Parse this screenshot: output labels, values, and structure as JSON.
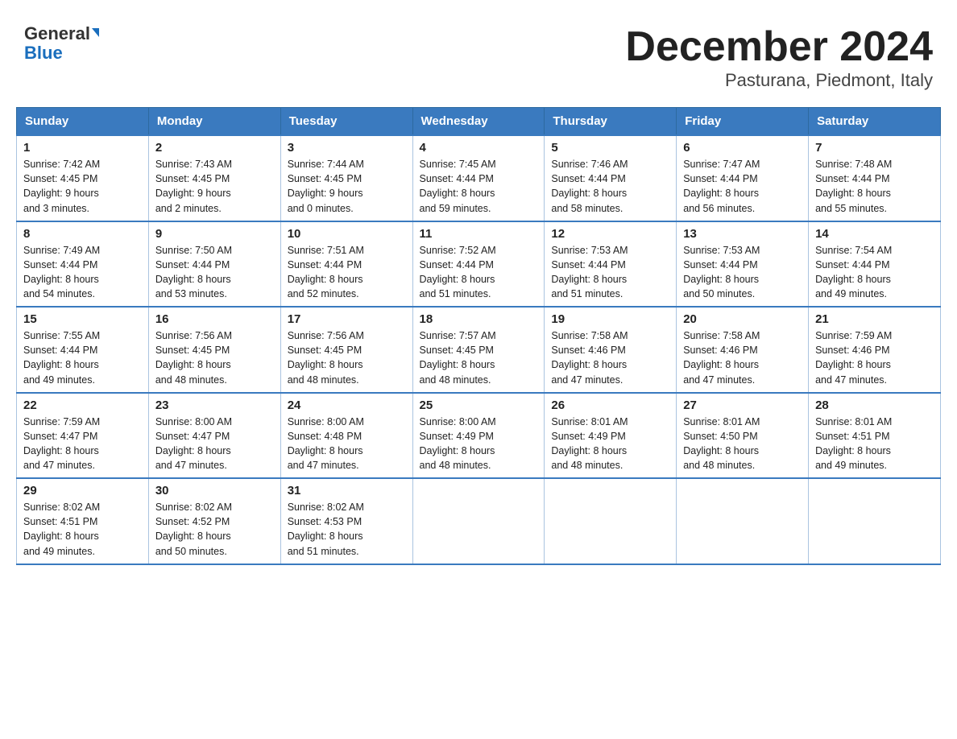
{
  "logo": {
    "general": "General",
    "arrow": "▶",
    "blue": "Blue"
  },
  "title": "December 2024",
  "subtitle": "Pasturana, Piedmont, Italy",
  "days_of_week": [
    "Sunday",
    "Monday",
    "Tuesday",
    "Wednesday",
    "Thursday",
    "Friday",
    "Saturday"
  ],
  "weeks": [
    [
      {
        "day": "1",
        "info": "Sunrise: 7:42 AM\nSunset: 4:45 PM\nDaylight: 9 hours\nand 3 minutes."
      },
      {
        "day": "2",
        "info": "Sunrise: 7:43 AM\nSunset: 4:45 PM\nDaylight: 9 hours\nand 2 minutes."
      },
      {
        "day": "3",
        "info": "Sunrise: 7:44 AM\nSunset: 4:45 PM\nDaylight: 9 hours\nand 0 minutes."
      },
      {
        "day": "4",
        "info": "Sunrise: 7:45 AM\nSunset: 4:44 PM\nDaylight: 8 hours\nand 59 minutes."
      },
      {
        "day": "5",
        "info": "Sunrise: 7:46 AM\nSunset: 4:44 PM\nDaylight: 8 hours\nand 58 minutes."
      },
      {
        "day": "6",
        "info": "Sunrise: 7:47 AM\nSunset: 4:44 PM\nDaylight: 8 hours\nand 56 minutes."
      },
      {
        "day": "7",
        "info": "Sunrise: 7:48 AM\nSunset: 4:44 PM\nDaylight: 8 hours\nand 55 minutes."
      }
    ],
    [
      {
        "day": "8",
        "info": "Sunrise: 7:49 AM\nSunset: 4:44 PM\nDaylight: 8 hours\nand 54 minutes."
      },
      {
        "day": "9",
        "info": "Sunrise: 7:50 AM\nSunset: 4:44 PM\nDaylight: 8 hours\nand 53 minutes."
      },
      {
        "day": "10",
        "info": "Sunrise: 7:51 AM\nSunset: 4:44 PM\nDaylight: 8 hours\nand 52 minutes."
      },
      {
        "day": "11",
        "info": "Sunrise: 7:52 AM\nSunset: 4:44 PM\nDaylight: 8 hours\nand 51 minutes."
      },
      {
        "day": "12",
        "info": "Sunrise: 7:53 AM\nSunset: 4:44 PM\nDaylight: 8 hours\nand 51 minutes."
      },
      {
        "day": "13",
        "info": "Sunrise: 7:53 AM\nSunset: 4:44 PM\nDaylight: 8 hours\nand 50 minutes."
      },
      {
        "day": "14",
        "info": "Sunrise: 7:54 AM\nSunset: 4:44 PM\nDaylight: 8 hours\nand 49 minutes."
      }
    ],
    [
      {
        "day": "15",
        "info": "Sunrise: 7:55 AM\nSunset: 4:44 PM\nDaylight: 8 hours\nand 49 minutes."
      },
      {
        "day": "16",
        "info": "Sunrise: 7:56 AM\nSunset: 4:45 PM\nDaylight: 8 hours\nand 48 minutes."
      },
      {
        "day": "17",
        "info": "Sunrise: 7:56 AM\nSunset: 4:45 PM\nDaylight: 8 hours\nand 48 minutes."
      },
      {
        "day": "18",
        "info": "Sunrise: 7:57 AM\nSunset: 4:45 PM\nDaylight: 8 hours\nand 48 minutes."
      },
      {
        "day": "19",
        "info": "Sunrise: 7:58 AM\nSunset: 4:46 PM\nDaylight: 8 hours\nand 47 minutes."
      },
      {
        "day": "20",
        "info": "Sunrise: 7:58 AM\nSunset: 4:46 PM\nDaylight: 8 hours\nand 47 minutes."
      },
      {
        "day": "21",
        "info": "Sunrise: 7:59 AM\nSunset: 4:46 PM\nDaylight: 8 hours\nand 47 minutes."
      }
    ],
    [
      {
        "day": "22",
        "info": "Sunrise: 7:59 AM\nSunset: 4:47 PM\nDaylight: 8 hours\nand 47 minutes."
      },
      {
        "day": "23",
        "info": "Sunrise: 8:00 AM\nSunset: 4:47 PM\nDaylight: 8 hours\nand 47 minutes."
      },
      {
        "day": "24",
        "info": "Sunrise: 8:00 AM\nSunset: 4:48 PM\nDaylight: 8 hours\nand 47 minutes."
      },
      {
        "day": "25",
        "info": "Sunrise: 8:00 AM\nSunset: 4:49 PM\nDaylight: 8 hours\nand 48 minutes."
      },
      {
        "day": "26",
        "info": "Sunrise: 8:01 AM\nSunset: 4:49 PM\nDaylight: 8 hours\nand 48 minutes."
      },
      {
        "day": "27",
        "info": "Sunrise: 8:01 AM\nSunset: 4:50 PM\nDaylight: 8 hours\nand 48 minutes."
      },
      {
        "day": "28",
        "info": "Sunrise: 8:01 AM\nSunset: 4:51 PM\nDaylight: 8 hours\nand 49 minutes."
      }
    ],
    [
      {
        "day": "29",
        "info": "Sunrise: 8:02 AM\nSunset: 4:51 PM\nDaylight: 8 hours\nand 49 minutes."
      },
      {
        "day": "30",
        "info": "Sunrise: 8:02 AM\nSunset: 4:52 PM\nDaylight: 8 hours\nand 50 minutes."
      },
      {
        "day": "31",
        "info": "Sunrise: 8:02 AM\nSunset: 4:53 PM\nDaylight: 8 hours\nand 51 minutes."
      },
      null,
      null,
      null,
      null
    ]
  ]
}
